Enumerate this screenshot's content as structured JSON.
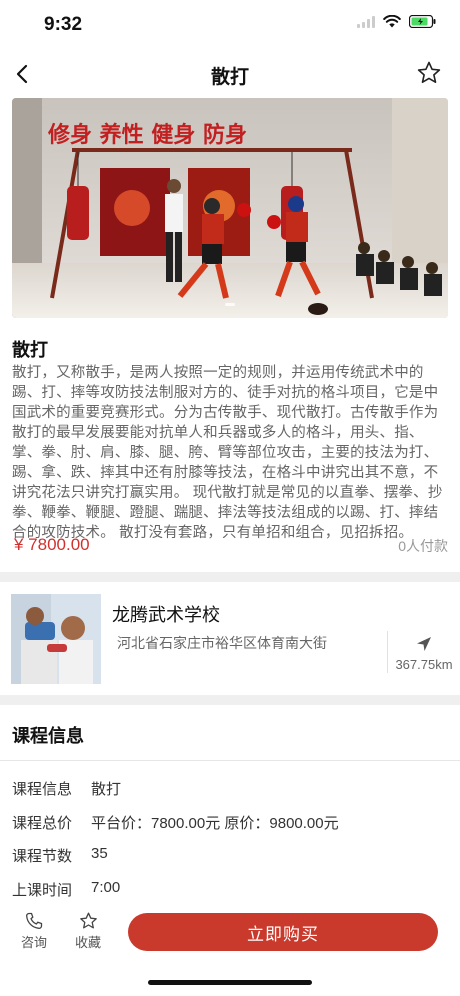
{
  "status": {
    "time": "9:32",
    "battery_color": "#4cd964"
  },
  "nav": {
    "title": "散打"
  },
  "hero": {
    "banner_text": "修身 养性 健身 防身",
    "slide_count": 1
  },
  "course": {
    "name": "散打",
    "description": "散打，又称散手，是两人按照一定的规则，并运用传统武术中的踢、打、摔等攻防技法制服对方的、徒手对抗的格斗项目，它是中国武术的重要竞赛形式。分为古传散手、现代散打。古传散手作为散打的最早发展要能对抗单人和兵器或多人的格斗，用头、指、掌、拳、肘、肩、膝、腿、胯、臂等部位攻击，主要的技法为打、踢、拿、跌、摔其中还有肘膝等技法，在格斗中讲究出其不意，不讲究花法只讲究打赢实用。 现代散打就是常见的以直拳、摆拳、抄拳、鞭拳、鞭腿、蹬腿、踹腿、摔法等技法组成的以踢、打、摔结合的攻防技术。 散打没有套路，只有单招和组合，见招拆招。",
    "price": "¥ 7800.00",
    "paid_count": "0人付款",
    "accent_color": "#d0312d"
  },
  "school": {
    "name": "龙腾武术学校",
    "address": "河北省石家庄市裕华区体育南大街",
    "distance": "367.75km"
  },
  "info": {
    "title": "课程信息",
    "rows": [
      {
        "key": "课程信息",
        "value": "散打"
      },
      {
        "key": "课程总价",
        "value": "平台价：7800.00元  原价：9800.00元"
      },
      {
        "key": "课程节数",
        "value": "35"
      },
      {
        "key": "上课时间",
        "value": "7:00"
      }
    ]
  },
  "bottom": {
    "consult_label": "咨询",
    "favorite_label": "收藏",
    "buy_label": "立即购买",
    "buy_color": "#c93a2c"
  }
}
